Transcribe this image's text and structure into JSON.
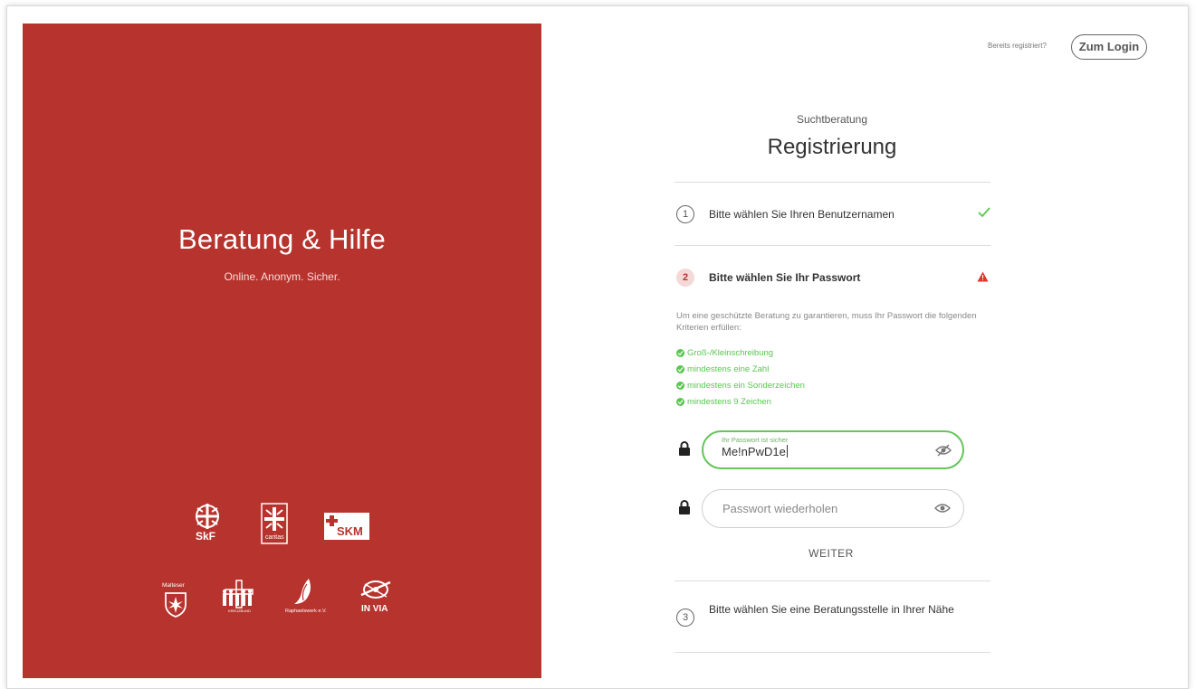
{
  "branding": {
    "title": "Beratung & Hilfe",
    "tagline": "Online. Anonym. Sicher.",
    "panel_color": "#b7332d",
    "logos": [
      {
        "name": "skf",
        "text": "SkF"
      },
      {
        "name": "caritas",
        "text": "caritas"
      },
      {
        "name": "skm",
        "text": "SKM"
      },
      {
        "name": "malteser",
        "text": "Malteser"
      },
      {
        "name": "kreuzbund",
        "text": "KREUZBUND"
      },
      {
        "name": "raphaelswerk",
        "text": "Raphaelswerk e.V."
      },
      {
        "name": "invia",
        "text": "IN VIA"
      }
    ]
  },
  "header": {
    "login_hint": "Bereits registriert?",
    "login_button": "Zum Login"
  },
  "form": {
    "agency": "Suchtberatung",
    "title": "Registrierung",
    "steps": [
      {
        "number": "1",
        "label": "Bitte wählen Sie Ihren Benutzernamen",
        "status": "complete"
      },
      {
        "number": "2",
        "label": "Bitte wählen Sie Ihr Passwort",
        "status": "warning"
      },
      {
        "number": "3",
        "label": "Bitte wählen Sie eine Beratungsstelle in Ihrer Nähe",
        "status": "pending"
      }
    ],
    "password_info": "Um eine geschützte Beratung zu garantieren, muss Ihr Passwort die folgenden Kriterien erfüllen:",
    "criteria": [
      "Groß-/Kleinschreibung",
      "mindestens eine Zahl",
      "mindestens ein Sonderzeichen",
      "mindestens 9 Zeichen"
    ],
    "password_field": {
      "label": "Ihr Passwort ist sicher",
      "value": "Me!nPwD1e"
    },
    "repeat_field": {
      "placeholder": "Passwort wiederholen",
      "value": ""
    },
    "next_button": "WEITER",
    "colors": {
      "success": "#58c64e",
      "warning": "#e0342c",
      "accent": "#b7332d"
    }
  }
}
